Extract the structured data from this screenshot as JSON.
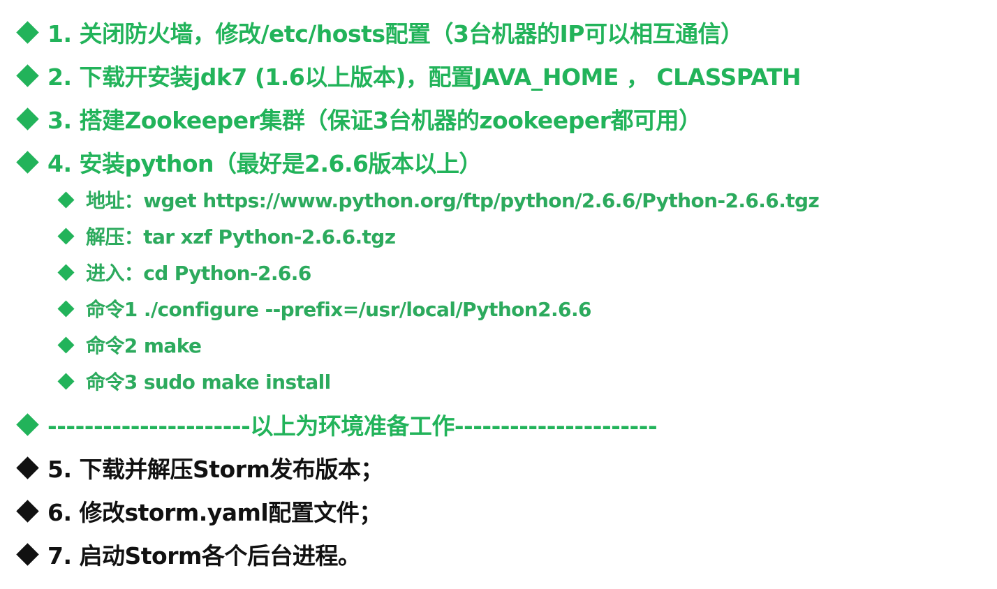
{
  "colors": {
    "green": "#22b35a",
    "sub_green": "#2caa5d",
    "black": "#111111"
  },
  "bullet_icon": "diamond",
  "items": [
    {
      "text": "1. 关闭防火墙，修改/etc/hosts配置（3台机器的IP可以相互通信）"
    },
    {
      "text": "2. 下载开安装jdk7 (1.6以上版本)，配置JAVA_HOME ， CLASSPATH"
    },
    {
      "text": "3. 搭建Zookeeper集群（保证3台机器的zookeeper都可用）"
    },
    {
      "text": "4. 安装python（最好是2.6.6版本以上）"
    }
  ],
  "sub_items": [
    {
      "text": "地址：wget https://www.python.org/ftp/python/2.6.6/Python-2.6.6.tgz"
    },
    {
      "text": "解压：tar xzf Python-2.6.6.tgz"
    },
    {
      "text": "进入：cd Python-2.6.6"
    },
    {
      "text": "命令1 ./configure --prefix=/usr/local/Python2.6.6"
    },
    {
      "text": "命令2 make"
    },
    {
      "text": "命令3 sudo make install"
    }
  ],
  "separator": {
    "text": "----------------------以上为环境准备工作----------------------"
  },
  "steps": [
    {
      "text": "5. 下载并解压Storm发布版本；"
    },
    {
      "text": "6. 修改storm.yaml配置文件；"
    },
    {
      "text": "7. 启动Storm各个后台进程。"
    }
  ]
}
